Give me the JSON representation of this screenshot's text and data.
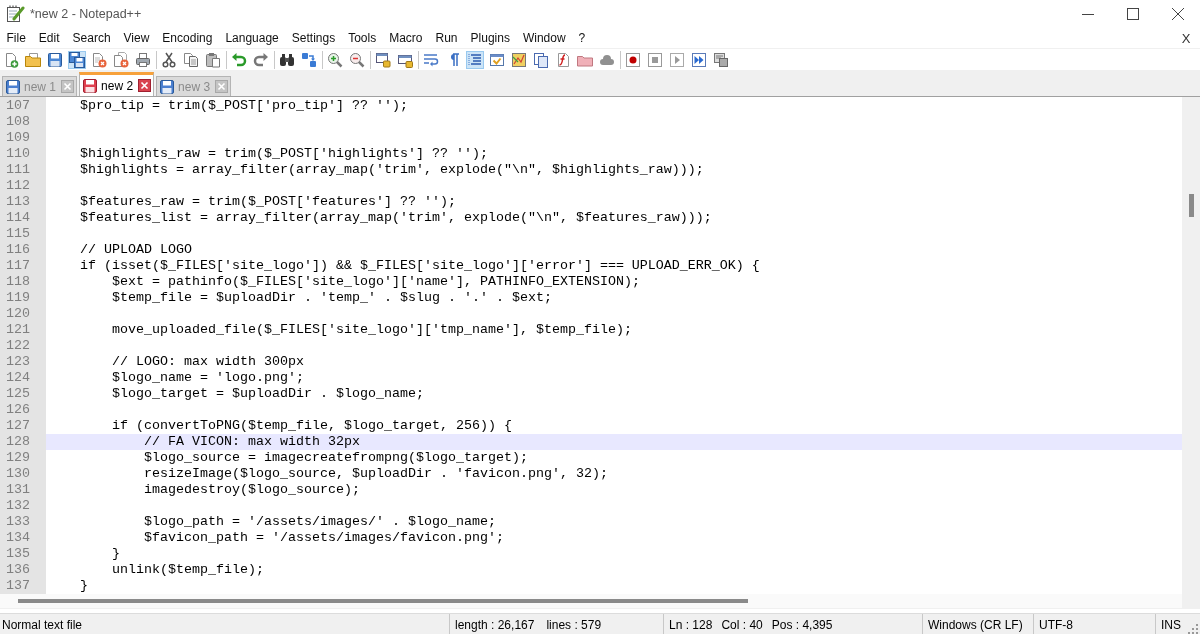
{
  "window": {
    "title": "*new 2 - Notepad++"
  },
  "menu": {
    "items": [
      "File",
      "Edit",
      "Search",
      "View",
      "Encoding",
      "Language",
      "Settings",
      "Tools",
      "Macro",
      "Run",
      "Plugins",
      "Window",
      "?"
    ],
    "close_document": "X"
  },
  "toolbar": {
    "groups": [
      {
        "buttons": [
          {
            "pressed": false
          },
          {
            "pressed": false
          },
          {
            "pressed": false
          },
          {
            "pressed": true
          },
          {
            "pressed": false
          },
          {
            "pressed": false
          },
          {
            "pressed": false
          }
        ]
      },
      {
        "buttons": [
          {
            "pressed": false
          },
          {
            "pressed": false
          },
          {
            "pressed": false
          }
        ]
      },
      {
        "buttons": [
          {
            "pressed": false
          },
          {
            "pressed": false
          }
        ]
      },
      {
        "buttons": [
          {
            "pressed": false
          },
          {
            "pressed": false
          }
        ]
      },
      {
        "buttons": [
          {
            "pressed": false
          },
          {
            "pressed": false
          }
        ]
      },
      {
        "buttons": [
          {
            "pressed": false
          },
          {
            "pressed": false
          }
        ]
      },
      {
        "buttons": [
          {
            "pressed": false
          },
          {
            "pressed": false
          },
          {
            "pressed": true
          },
          {
            "pressed": false
          },
          {
            "pressed": false
          },
          {
            "pressed": false
          },
          {
            "pressed": false
          },
          {
            "pressed": false
          },
          {
            "pressed": false
          }
        ]
      },
      {
        "buttons": [
          {
            "pressed": false
          },
          {
            "pressed": false
          },
          {
            "pressed": false
          },
          {
            "pressed": false
          },
          {
            "pressed": false
          }
        ]
      }
    ]
  },
  "tabs": [
    {
      "label": "new 1",
      "selected": false,
      "modified": false
    },
    {
      "label": "new 2",
      "selected": true,
      "modified": true
    },
    {
      "label": "new 3",
      "selected": false,
      "modified": false
    }
  ],
  "editor": {
    "lines": [
      {
        "number": "107",
        "text": "    $pro_tip = trim($_POST['pro_tip'] ?? '');",
        "current": false
      },
      {
        "number": "108",
        "current": false
      },
      {
        "number": "109",
        "current": false
      },
      {
        "number": "110",
        "text": "    $highlights_raw = trim($_POST['highlights'] ?? '');",
        "current": false
      },
      {
        "number": "111",
        "text": "    $highlights = array_filter(array_map('trim', explode(\"\\n\", $highlights_raw)));",
        "current": false
      },
      {
        "number": "112",
        "current": false
      },
      {
        "number": "113",
        "text": "    $features_raw = trim($_POST['features'] ?? '');",
        "current": false
      },
      {
        "number": "114",
        "text": "    $features_list = array_filter(array_map('trim', explode(\"\\n\", $features_raw)));",
        "current": false
      },
      {
        "number": "115",
        "current": false
      },
      {
        "number": "116",
        "text": "    // UPLOAD LOGO",
        "current": false
      },
      {
        "number": "117",
        "text": "    if (isset($_FILES['site_logo']) && $_FILES['site_logo']['error'] === UPLOAD_ERR_OK) {",
        "current": false
      },
      {
        "number": "118",
        "text": "        $ext = pathinfo($_FILES['site_logo']['name'], PATHINFO_EXTENSION);",
        "current": false
      },
      {
        "number": "119",
        "text": "        $temp_file = $uploadDir . 'temp_' . $slug . '.' . $ext;",
        "current": false
      },
      {
        "number": "120",
        "current": false
      },
      {
        "number": "121",
        "text": "        move_uploaded_file($_FILES['site_logo']['tmp_name'], $temp_file);",
        "current": false
      },
      {
        "number": "122",
        "current": false
      },
      {
        "number": "123",
        "text": "        // LOGO: max width 300px",
        "current": false
      },
      {
        "number": "124",
        "text": "        $logo_name = 'logo.png';",
        "current": false
      },
      {
        "number": "125",
        "text": "        $logo_target = $uploadDir . $logo_name;",
        "current": false
      },
      {
        "number": "126",
        "current": false
      },
      {
        "number": "127",
        "text": "        if (convertToPNG($temp_file, $logo_target, 256)) {",
        "current": false
      },
      {
        "number": "128",
        "text": "            // FA VICON: max width 32px",
        "current": true
      },
      {
        "number": "129",
        "text": "            $logo_source = imagecreatefrompng($logo_target);",
        "current": false
      },
      {
        "number": "130",
        "text": "            resizeImage($logo_source, $uploadDir . 'favicon.png', 32);",
        "current": false
      },
      {
        "number": "131",
        "text": "            imagedestroy($logo_source);",
        "current": false
      },
      {
        "number": "132",
        "current": false
      },
      {
        "number": "133",
        "text": "            $logo_path = '/assets/images/' . $logo_name;",
        "current": false
      },
      {
        "number": "134",
        "text": "            $favicon_path = '/assets/images/favicon.png';",
        "current": false
      },
      {
        "number": "135",
        "text": "        }",
        "current": false
      },
      {
        "number": "136",
        "text": "        unlink($temp_file);",
        "current": false
      },
      {
        "number": "137",
        "text": "    }",
        "current": false
      }
    ]
  },
  "status_bar": {
    "file_type": "Normal text file",
    "length": "length : 26,167",
    "lines": "lines : 579",
    "line": "Ln : 128",
    "column": "Col : 40",
    "position": "Pos : 4,395",
    "eol": "Windows (CR LF)",
    "encoding": "UTF-8",
    "mode": "INS"
  }
}
